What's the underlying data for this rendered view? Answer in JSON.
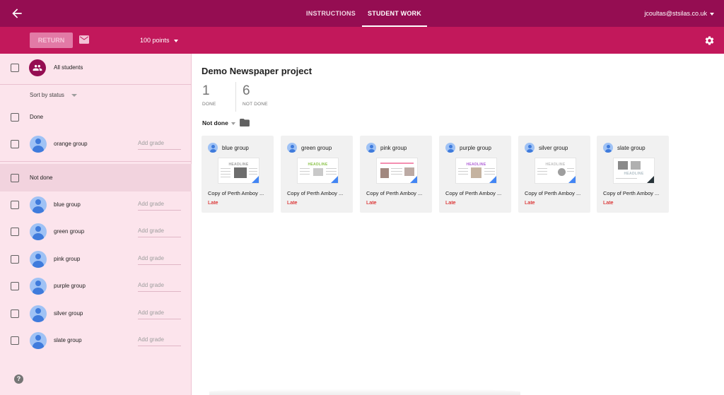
{
  "topbar": {
    "tabs": [
      {
        "label": "INSTRUCTIONS"
      },
      {
        "label": "STUDENT WORK"
      }
    ],
    "account": "jcoultas@stsilas.co.uk",
    "bg_color": "#950d52"
  },
  "toolbar": {
    "return_label": "RETURN",
    "points_label": "100 points",
    "bg_color": "#c2185b"
  },
  "sidebar": {
    "all_students_label": "All students",
    "sort_label": "Sort by status",
    "done_header": "Done",
    "not_done_header": "Not done",
    "grade_placeholder": "Add grade",
    "done_students": [
      {
        "name": "orange group"
      }
    ],
    "not_done_students": [
      {
        "name": "blue group"
      },
      {
        "name": "green group"
      },
      {
        "name": "pink group"
      },
      {
        "name": "purple group"
      },
      {
        "name": "silver group"
      },
      {
        "name": "slate group"
      }
    ],
    "help_glyph": "?"
  },
  "main": {
    "title": "Demo Newspaper project",
    "stats": [
      {
        "value": "1",
        "label": "DONE"
      },
      {
        "value": "6",
        "label": "NOT DONE"
      }
    ],
    "filter_label": "Not done",
    "cards": [
      {
        "name": "blue group",
        "file": "Copy of Perth Amboy ...",
        "status": "Late",
        "headline": "HEADLINE",
        "headline_color": "#9e9e9e"
      },
      {
        "name": "green group",
        "file": "Copy of Perth Amboy ...",
        "status": "Late",
        "headline": "HEADLINE",
        "headline_color": "#8bc34a"
      },
      {
        "name": "pink group",
        "file": "Copy of Perth Amboy ...",
        "status": "Late",
        "headline": "",
        "headline_color": "#e91e63"
      },
      {
        "name": "purple group",
        "file": "Copy of Perth Amboy ...",
        "status": "Late",
        "headline": "HEADLINE",
        "headline_color": "#b05fd6"
      },
      {
        "name": "silver group",
        "file": "Copy of Perth Amboy ...",
        "status": "Late",
        "headline": "HEADLINE",
        "headline_color": "#bdbdbd"
      },
      {
        "name": "slate group",
        "file": "Copy of Perth Amboy ...",
        "status": "Late",
        "headline": "HEADLINE",
        "headline_color": "#b0bec5"
      }
    ]
  }
}
